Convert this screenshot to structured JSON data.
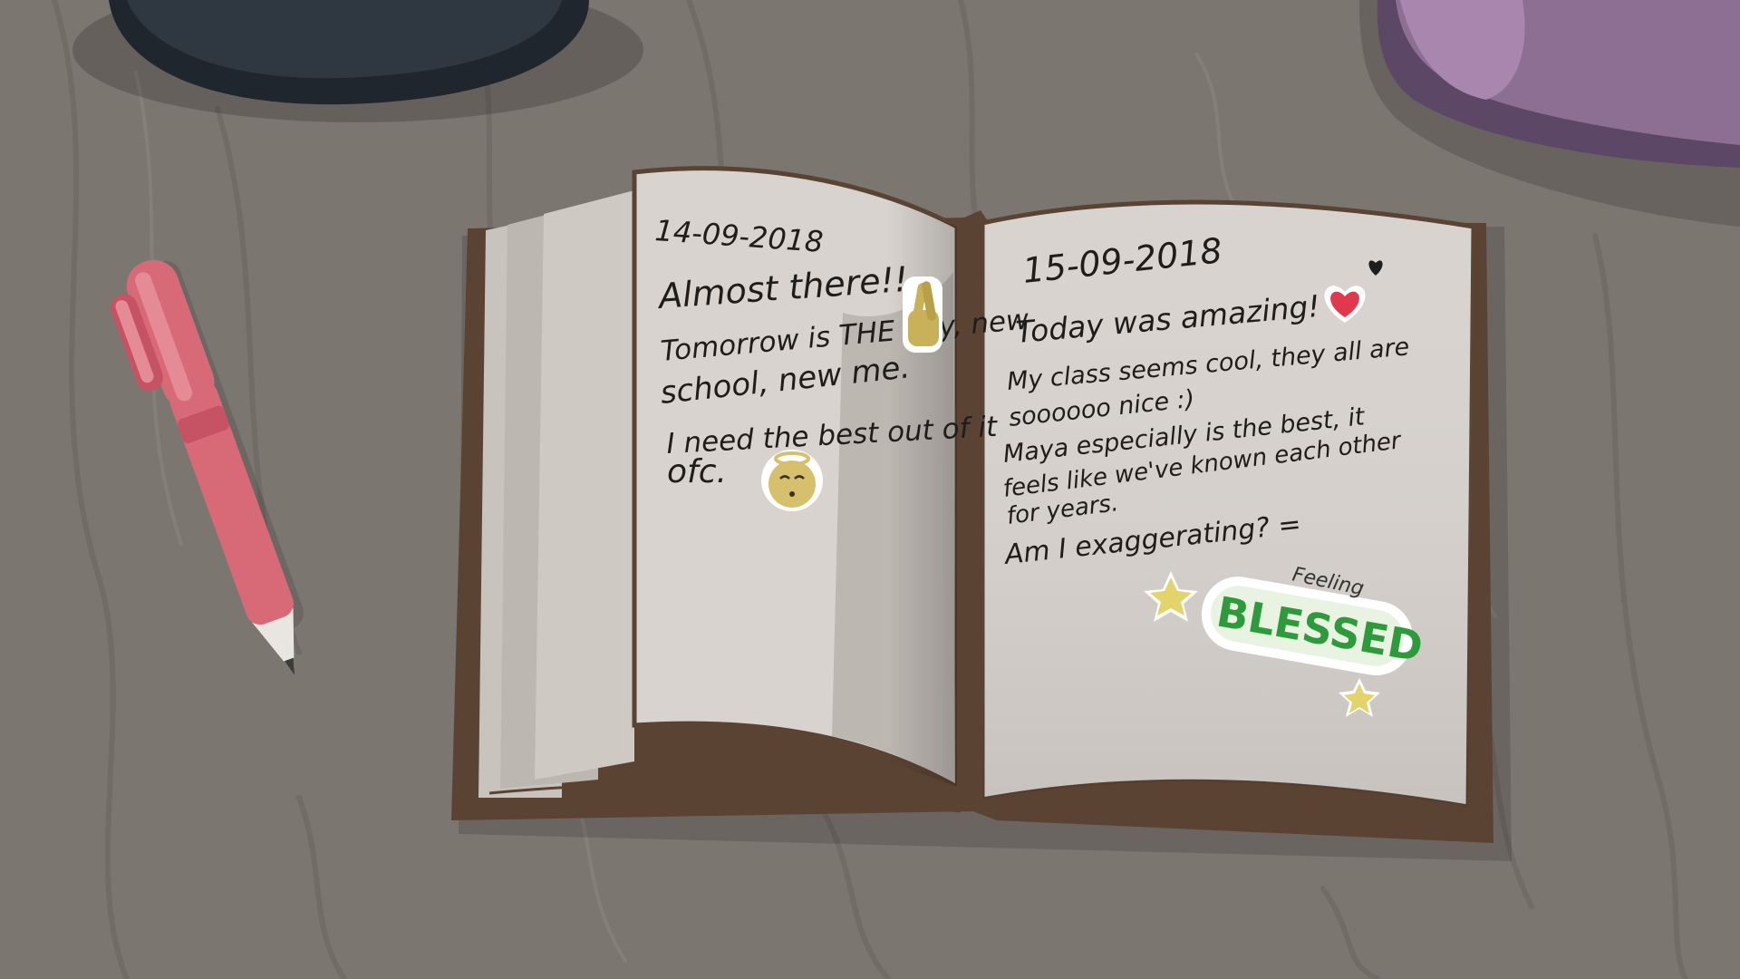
{
  "scene": {
    "colors": {
      "table": "#7c7671",
      "table_grain": "#8a847f",
      "page": "#d8d3ce",
      "page_shadow": "#b9b3ae",
      "cover": "#5b4333",
      "ink": "#1f1d1c",
      "pen_body": "#d86a78",
      "heart": "#e0394f",
      "sticker_green": "#2f9a3b",
      "star": "#e3d36a",
      "hat_dark": "#2f3841",
      "hat_purple": "#a886ad"
    }
  },
  "journal": {
    "left_page": {
      "date": "14-09-2018",
      "lines": [
        "Almost there!!",
        "Tomorrow is THE day, new",
        "school, new me.",
        "I need the best out of it",
        "ofc."
      ],
      "stickers": [
        "fingers-crossed-sticker",
        "angel-face-sticker"
      ]
    },
    "right_page": {
      "date": "15-09-2018",
      "lines": [
        "Today was amazing!",
        "My class seems cool, they all are",
        "soooooo nice :)",
        "Maya especially is the best, it",
        "feels like we've known each other",
        "for years.",
        "Am I exaggerating? ="
      ],
      "sticker_small_text": "Feeling",
      "sticker_big_text": "BLESSED",
      "stickers": [
        "heart-sticker",
        "star-sticker",
        "star-sticker-2"
      ]
    }
  }
}
